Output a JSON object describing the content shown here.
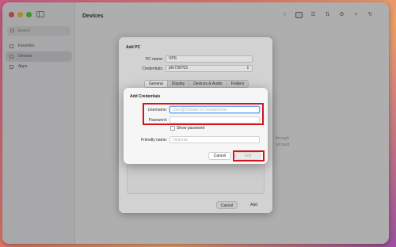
{
  "window": {
    "title": "Devices"
  },
  "sidebar": {
    "search_placeholder": "Search",
    "items": [
      {
        "label": "Favorites",
        "icon": "star-icon"
      },
      {
        "label": "Devices",
        "icon": "monitor-icon"
      },
      {
        "label": "Apps",
        "icon": "apps-icon"
      }
    ]
  },
  "main": {
    "empty_text_line1": "through",
    "empty_text_line2": "account"
  },
  "add_pc_sheet": {
    "title": "Add PC",
    "pc_name_label": "PC name:",
    "pc_name_value": "VPS",
    "credentials_label": "Credentials:",
    "credentials_value": "phr730703",
    "tabs": [
      "General",
      "Display",
      "Devices & Audio",
      "Folders"
    ],
    "cancel_label": "Cancel",
    "add_label": "Add"
  },
  "add_credentials_dialog": {
    "title": "Add Credentials",
    "username_label": "Username:",
    "username_placeholder": "User@Domain or Domain\\User",
    "password_label": "Password:",
    "show_password_label": "Show password",
    "friendly_name_label": "Friendly name:",
    "friendly_name_placeholder": "Optional",
    "cancel_label": "Cancel",
    "add_label": "Add"
  },
  "colors": {
    "highlight": "#d6121a",
    "focus_ring": "#6ba4ee"
  }
}
